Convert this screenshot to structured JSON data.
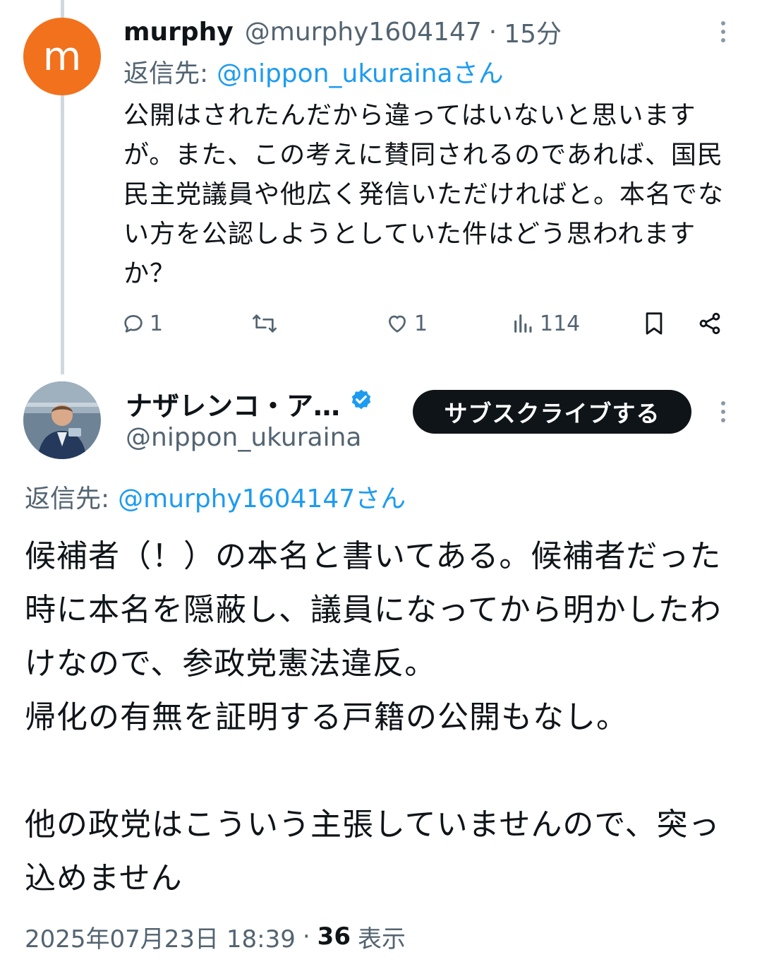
{
  "reply1": {
    "avatar_letter": "m",
    "display_name": "murphy",
    "handle": "@murphy1604147",
    "separator": "·",
    "time": "15分",
    "reply_to_prefix": "返信先:",
    "reply_to_handle": "@nippon_ukurainaさん",
    "text": "公開はされたんだから違ってはいないと思いますが。また、この考えに賛同されるのであれば、国民民主党議員や他広く発信いただければと。本名でない方を公認しようとしていた件はどう思われますか？",
    "replies_count": "1",
    "reposts_count": "",
    "likes_count": "1",
    "views_count": "114"
  },
  "main_post": {
    "display_name": "ナザレンコ・ア…",
    "handle": "@nippon_ukuraina",
    "verified": true,
    "subscribe_label": "サブスクライブする",
    "reply_to_prefix": "返信先:",
    "reply_to_handle": "@murphy1604147さん",
    "paragraphs": [
      "候補者（！）の本名と書いてある。候補者だった時に本名を隠蔽し、議員になってから明かしたわけなので、参政党憲法違反。",
      "帰化の有無を証明する戸籍の公開もなし。",
      "他の政党はこういう主張していませんので、突っ込めません"
    ],
    "timestamp": "2025年07月23日 18:39",
    "separator": "·",
    "views_count": "36",
    "views_label": "表示"
  },
  "colors": {
    "accent": "#1d9bf0",
    "muted": "#536471",
    "avatar_bg": "#f2711c",
    "button_bg": "#0f1419"
  },
  "icons": [
    "more-icon",
    "reply-icon",
    "repost-icon",
    "like-icon",
    "views-icon",
    "bookmark-icon",
    "share-icon",
    "verified-badge-icon"
  ]
}
